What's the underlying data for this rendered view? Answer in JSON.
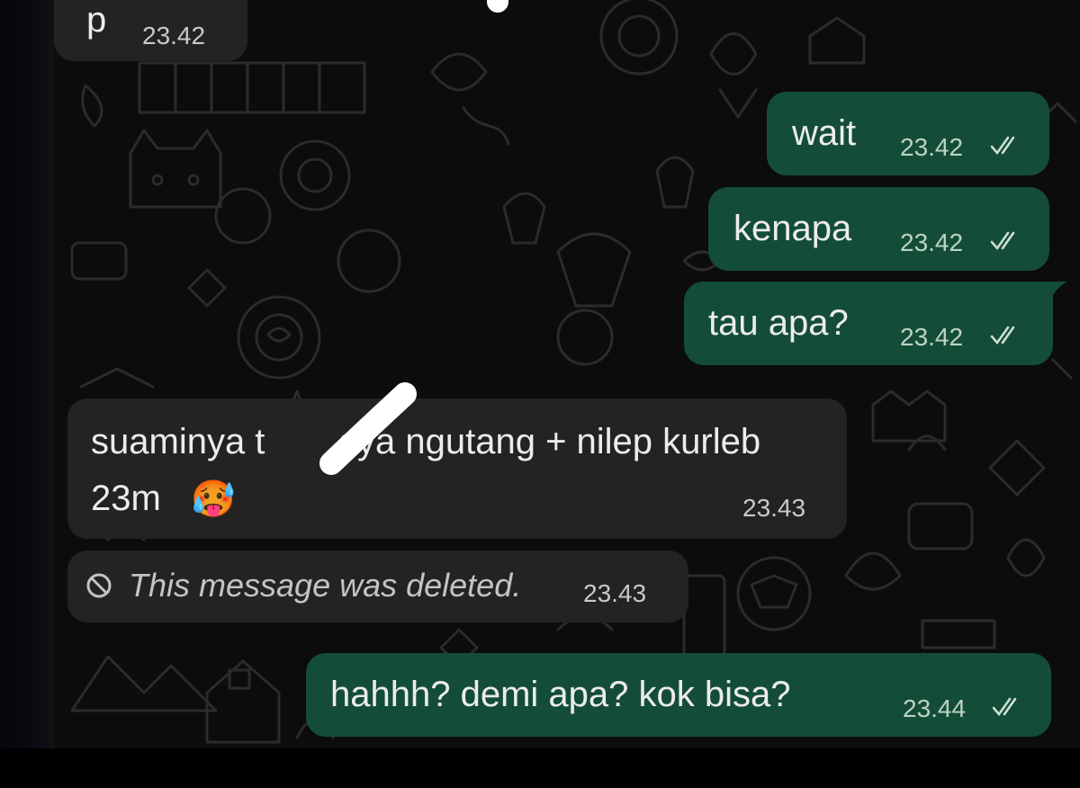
{
  "messages": [
    {
      "id": "m1",
      "direction": "incoming",
      "text": "p",
      "time": "23.42"
    },
    {
      "id": "m2",
      "direction": "outgoing",
      "text": "wait",
      "time": "23.42",
      "status": "read"
    },
    {
      "id": "m3",
      "direction": "outgoing",
      "text": "kenapa",
      "time": "23.42",
      "status": "read"
    },
    {
      "id": "m4",
      "direction": "outgoing",
      "text": "tau apa?",
      "time": "23.42",
      "status": "read"
    },
    {
      "id": "m5",
      "direction": "incoming",
      "text_line1": "suaminya t",
      "text_line1b": "sya ngutang + nilep kurleb",
      "text_line2": "23m",
      "emoji": "🥵",
      "time": "23.43"
    },
    {
      "id": "m6",
      "direction": "incoming",
      "deleted": true,
      "text": "This message was deleted.",
      "time": "23.43"
    },
    {
      "id": "m7",
      "direction": "outgoing",
      "text": "hahhh?  demi apa? kok bisa?",
      "time": "23.44",
      "status": "read"
    }
  ],
  "icons": {
    "read_receipt": "double-check-icon",
    "deleted": "prohibited-icon",
    "redaction": "white-scribble-mark"
  },
  "colors": {
    "incoming_bubble": "#232323",
    "outgoing_bubble": "#144d37",
    "background": "#0c0c0c",
    "doodle": "#2a2a2a"
  }
}
